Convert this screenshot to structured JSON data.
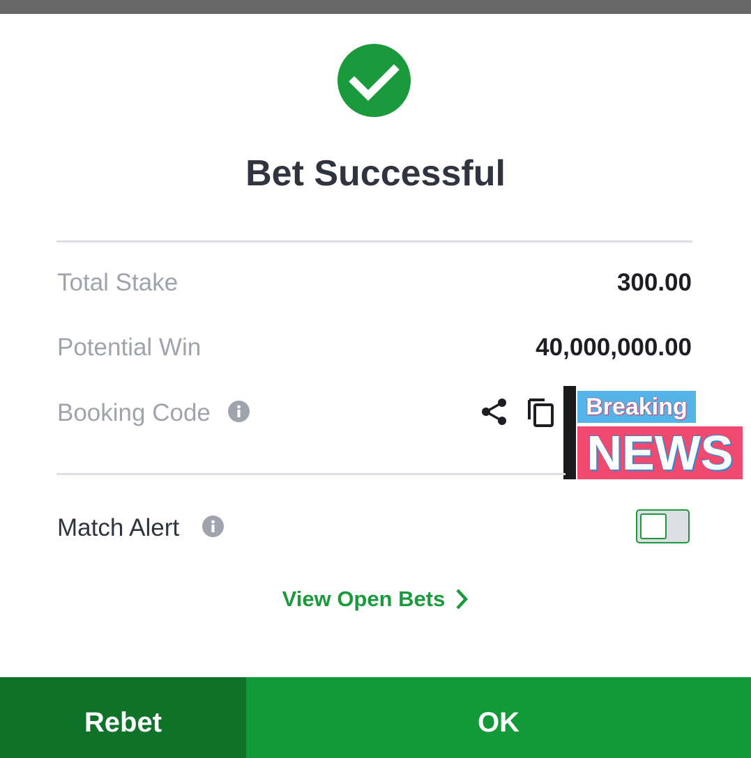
{
  "dialog": {
    "title": "Bet Successful"
  },
  "summary": {
    "total_stake_label": "Total Stake",
    "total_stake_value": "300.00",
    "potential_win_label": "Potential Win",
    "potential_win_value": "40,000,000.00",
    "booking_code_label": "Booking Code"
  },
  "overlay": {
    "breaking_label": "Breaking",
    "news_label": "NEWS"
  },
  "match_alert": {
    "label": "Match Alert",
    "enabled": false
  },
  "links": {
    "view_open_bets": "View Open Bets"
  },
  "actions": {
    "rebet_label": "Rebet",
    "ok_label": "OK"
  },
  "icons": {
    "success": "check-circle-icon",
    "info": "info-icon",
    "share": "share-icon",
    "copy": "copy-icon",
    "chevron": "chevron-right-icon"
  },
  "colors": {
    "accent_green": "#1a9a3c",
    "rebet_bg": "#0e7329",
    "ok_bg": "#119a37",
    "muted_text": "#9ea3ad",
    "primary_text": "#30343f"
  }
}
